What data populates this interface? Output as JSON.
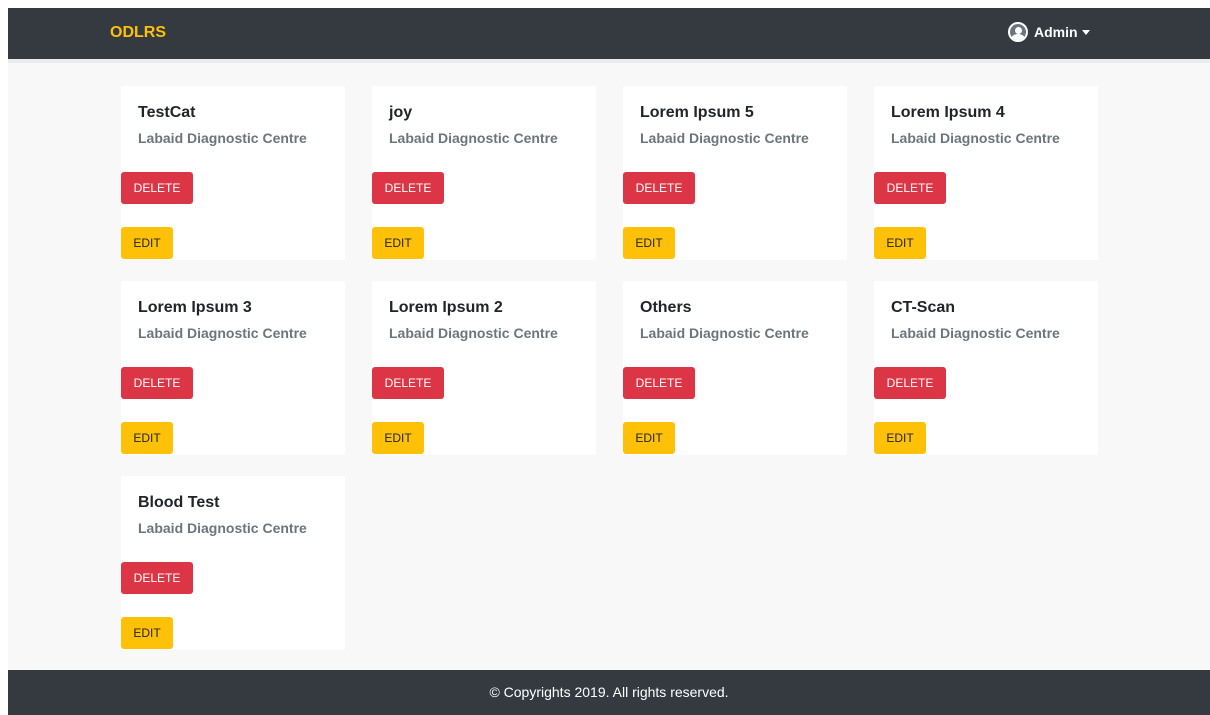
{
  "navbar": {
    "brand": "ODLRS",
    "user_label": "Admin",
    "user_icon": "user-circle-icon",
    "caret_icon": "caret-down-icon"
  },
  "buttons": {
    "delete_label": "DELETE",
    "edit_label": "EDIT"
  },
  "cards": [
    {
      "title": "TestCat",
      "subtitle": "Labaid Diagnostic Centre"
    },
    {
      "title": "joy",
      "subtitle": "Labaid Diagnostic Centre"
    },
    {
      "title": "Lorem Ipsum 5",
      "subtitle": "Labaid Diagnostic Centre"
    },
    {
      "title": "Lorem Ipsum 4",
      "subtitle": "Labaid Diagnostic Centre"
    },
    {
      "title": "Lorem Ipsum 3",
      "subtitle": "Labaid Diagnostic Centre"
    },
    {
      "title": "Lorem Ipsum 2",
      "subtitle": "Labaid Diagnostic Centre"
    },
    {
      "title": "Others",
      "subtitle": "Labaid Diagnostic Centre"
    },
    {
      "title": "CT-Scan",
      "subtitle": "Labaid Diagnostic Centre"
    },
    {
      "title": "Blood Test",
      "subtitle": "Labaid Diagnostic Centre"
    }
  ],
  "footer": {
    "text": "© Copyrights 2019. All rights reserved."
  },
  "colors": {
    "navbar_bg": "#343a40",
    "brand": "#ffc107",
    "delete": "#dc3545",
    "edit": "#ffc107"
  }
}
